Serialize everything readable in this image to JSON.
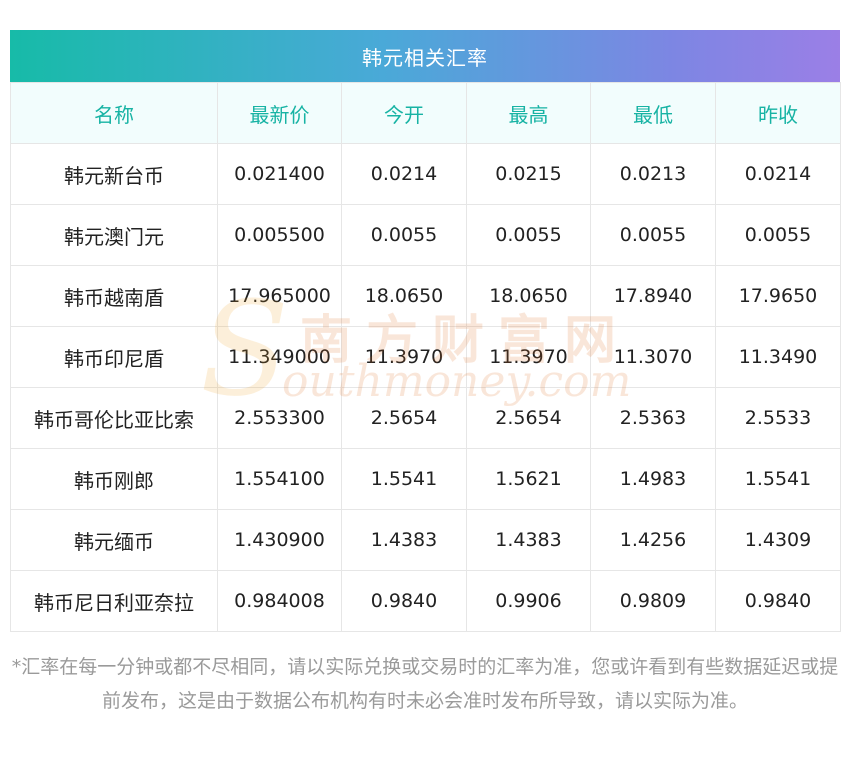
{
  "title": "韩元相关汇率",
  "headers": [
    "名称",
    "最新价",
    "今开",
    "最高",
    "最低",
    "昨收"
  ],
  "rows": [
    {
      "name": "韩元新台币",
      "latest": "0.021400",
      "open": "0.0214",
      "high": "0.0215",
      "low": "0.0213",
      "prev_close": "0.0214"
    },
    {
      "name": "韩元澳门元",
      "latest": "0.005500",
      "open": "0.0055",
      "high": "0.0055",
      "low": "0.0055",
      "prev_close": "0.0055"
    },
    {
      "name": "韩币越南盾",
      "latest": "17.965000",
      "open": "18.0650",
      "high": "18.0650",
      "low": "17.8940",
      "prev_close": "17.9650"
    },
    {
      "name": "韩币印尼盾",
      "latest": "11.349000",
      "open": "11.3970",
      "high": "11.3970",
      "low": "11.3070",
      "prev_close": "11.3490"
    },
    {
      "name": "韩币哥伦比亚比索",
      "latest": "2.553300",
      "open": "2.5654",
      "high": "2.5654",
      "low": "2.5363",
      "prev_close": "2.5533"
    },
    {
      "name": "韩币刚郎",
      "latest": "1.554100",
      "open": "1.5541",
      "high": "1.5621",
      "low": "1.4983",
      "prev_close": "1.5541"
    },
    {
      "name": "韩元缅币",
      "latest": "1.430900",
      "open": "1.4383",
      "high": "1.4383",
      "low": "1.4256",
      "prev_close": "1.4309"
    },
    {
      "name": "韩币尼日利亚奈拉",
      "latest": "0.984008",
      "open": "0.9840",
      "high": "0.9906",
      "low": "0.9809",
      "prev_close": "0.9840"
    }
  ],
  "watermark": {
    "cn": "南方财富网",
    "en": "outhmoney.com",
    "letter": "S"
  },
  "note": "*汇率在每一分钟或都不尽相同，请以实际兑换或交易时的汇率为准，您或许看到有些数据延迟或提前发布，这是由于数据公布机构有时未必会准时发布所导致，请以实际为准。",
  "colors": {
    "header_gradient_start": "#17bba8",
    "header_gradient_end": "#9b7fe6",
    "column_header_text": "#17b3a4",
    "column_header_bg": "#f2fdfd",
    "note_text": "#9a9a9a"
  }
}
